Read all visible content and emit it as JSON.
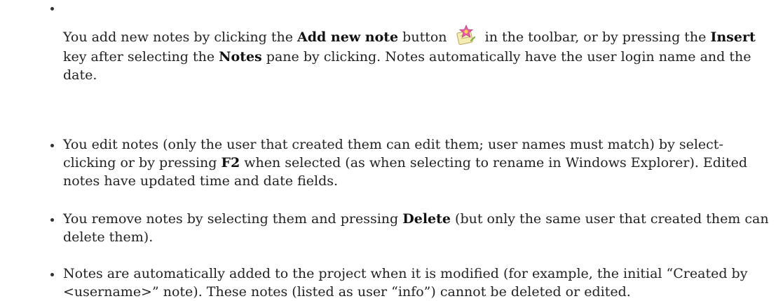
{
  "items": [
    {
      "p1": "You add new notes by clicking the ",
      "b1": "Add new note",
      "p2": " button ",
      "p3": " in the toolbar, or by pressing the ",
      "b2": "Insert",
      "p4": " key after selecting the ",
      "b3": "Notes",
      "p5": " pane by clicking. Notes automatically have the user login name and the date."
    },
    {
      "p1": "You edit notes (only the user that created them can edit them; user names must match) by select-clicking or by pressing ",
      "b1": "F2",
      "p2": " when selected (as when selecting to rename in Windows Explorer). Edited notes have updated time and date fields."
    },
    {
      "p1": "You remove notes by selecting them and pressing ",
      "b1": "Delete",
      "p2": " (but only the same user that created them can delete them)."
    },
    {
      "p1": "Notes are automatically added to the project when it is modified (for example, the initial “Created by <username>” note). These notes (listed as user “info”) cannot be deleted or edited."
    }
  ],
  "toolbar_icon": {
    "name": "add-new-note-icon",
    "colors": [
      "#f0e6a0",
      "#e64a9a",
      "#7fb43a"
    ]
  }
}
